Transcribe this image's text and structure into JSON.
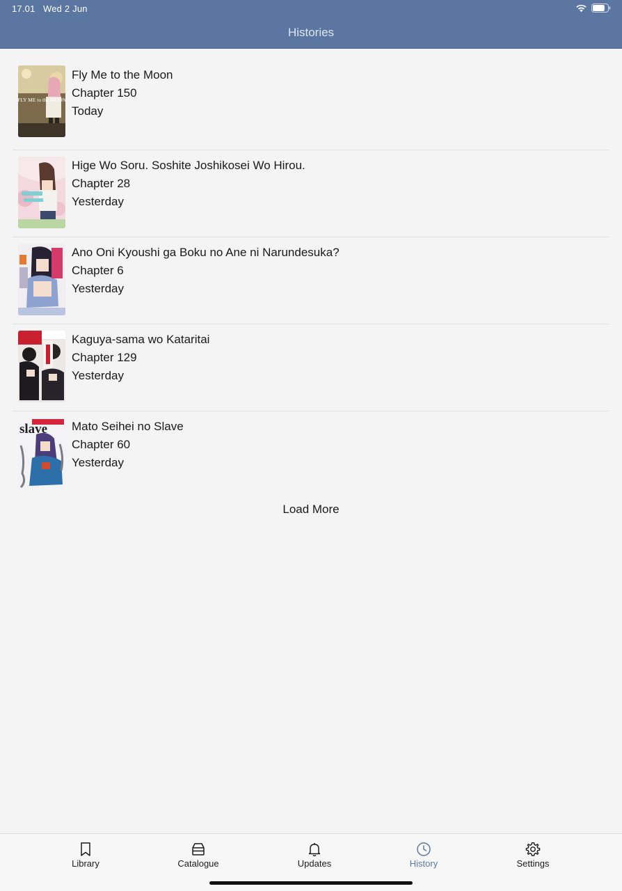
{
  "status_bar": {
    "time": "17.01",
    "date": "Wed 2 Jun",
    "wifi_icon": "wifi-icon",
    "battery_icon": "battery-icon",
    "battery_level": 0.8
  },
  "header": {
    "title": "Histories"
  },
  "history": {
    "items": [
      {
        "title": "Fly Me to the Moon",
        "chapter": "Chapter 150",
        "when": "Today",
        "cover_text": "FLY ME to the MOON"
      },
      {
        "title": "Hige Wo Soru. Soshite Joshikosei Wo Hirou.",
        "chapter": "Chapter 28",
        "when": "Yesterday"
      },
      {
        "title": "Ano Oni Kyoushi ga Boku no Ane ni Narundesuka?",
        "chapter": "Chapter 6",
        "when": "Yesterday"
      },
      {
        "title": "Kaguya-sama wo Kataritai",
        "chapter": "Chapter 129",
        "when": "Yesterday"
      },
      {
        "title": "Mato Seihei no Slave",
        "chapter": "Chapter 60",
        "when": "Yesterday",
        "cover_text": "slave"
      }
    ],
    "load_more_label": "Load More"
  },
  "tab_bar": {
    "tabs": [
      {
        "label": "Library",
        "icon": "bookmark-icon"
      },
      {
        "label": "Catalogue",
        "icon": "inbox-tray-icon"
      },
      {
        "label": "Updates",
        "icon": "bell-icon"
      },
      {
        "label": "History",
        "icon": "clock-icon"
      },
      {
        "label": "Settings",
        "icon": "gear-icon"
      }
    ],
    "active_tab": "History",
    "accent_color": "#5b76a0"
  },
  "colors": {
    "header_bg": "#5b76a0",
    "page_bg": "#f4f4f4"
  }
}
